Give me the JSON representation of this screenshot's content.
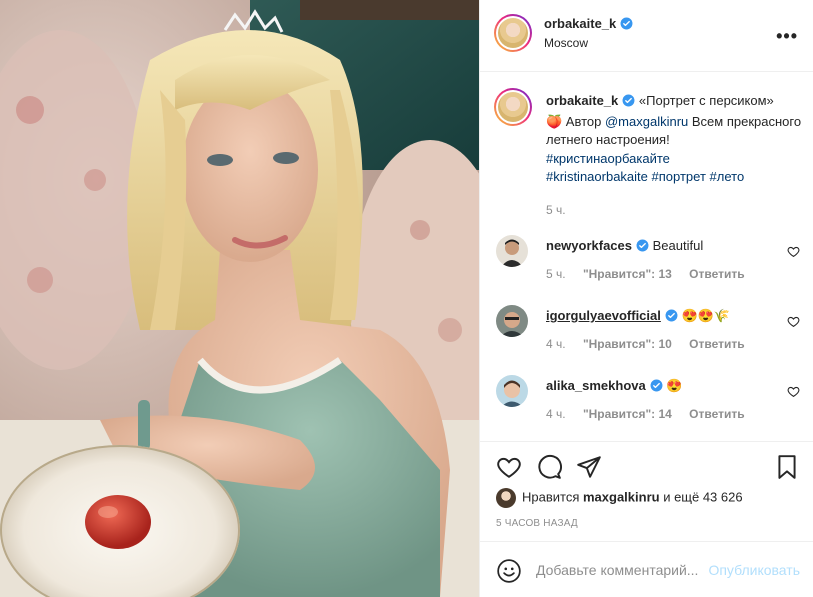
{
  "post": {
    "username": "orbakaite_k",
    "location": "Moscow",
    "more_label": "•••"
  },
  "caption": {
    "username": "orbakaite_k",
    "quote": "«Портрет с персиком»",
    "emoji": "🍑",
    "author_prefix": " Автор ",
    "mention": "@maxgalkinru",
    "rest": " Всем прекрасного летнего настроения!",
    "hashtags": [
      "#кристинаорбакайте",
      "#kristinaorbakaite",
      "#портрет",
      "#лето"
    ],
    "time": "5 ч."
  },
  "comments": [
    {
      "username": "newyorkfaces",
      "verified": true,
      "text": "Beautiful",
      "time": "5 ч.",
      "likes": "\"Нравится\": 13",
      "reply": "Ответить"
    },
    {
      "username": "igorgulyaevofficial",
      "verified": true,
      "text": "😍😍🌾",
      "time": "4 ч.",
      "likes": "\"Нравится\": 10",
      "reply": "Ответить"
    },
    {
      "username": "alika_smekhova",
      "verified": true,
      "text": "😍",
      "time": "4 ч.",
      "likes": "\"Нравится\": 14",
      "reply": "Ответить"
    }
  ],
  "likes": {
    "prefix": "Нравится ",
    "user": "maxgalkinru",
    "suffix": " и ещё 43 626"
  },
  "posted_ago": "5 ЧАСОВ НАЗАД",
  "add_comment": {
    "placeholder": "Добавьте комментарий...",
    "post_label": "Опубликовать"
  },
  "colors": {
    "verified": "#3897f0",
    "hashtag": "#00376b",
    "muted": "#8e8e8e",
    "post_disabled": "#b2dffc"
  }
}
